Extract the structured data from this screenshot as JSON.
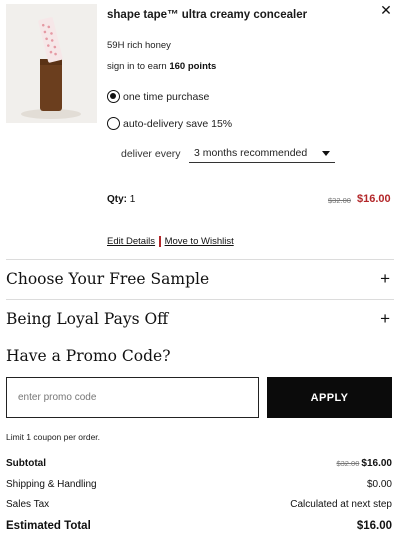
{
  "product": {
    "name": "shape tape™ ultra creamy concealer",
    "shade": "59H rich honey",
    "points_prefix": "sign in to earn",
    "points_value": "160 points",
    "close_icon": "close-icon",
    "purchase_options": [
      {
        "label": "one time purchase",
        "selected": true
      },
      {
        "label": "auto-delivery save 15%",
        "selected": false
      }
    ],
    "deliver_label": "deliver every",
    "deliver_value": "3 months recommended",
    "qty_label": "Qty:",
    "qty_value": "1",
    "price_original": "$32.00",
    "price_current": "$16.00",
    "edit_link": "Edit Details",
    "wishlist_link": "Move to Wishlist"
  },
  "accordions": [
    {
      "title": "Choose Your Free Sample",
      "icon": "plus-icon"
    },
    {
      "title": "Being Loyal Pays Off",
      "icon": "plus-icon"
    }
  ],
  "promo": {
    "title": "Have a Promo Code?",
    "placeholder": "enter promo code",
    "button": "APPLY",
    "limit_note": "Limit 1 coupon per order."
  },
  "summary": {
    "subtotal_label": "Subtotal",
    "subtotal_original": "$32.00",
    "subtotal_value": "$16.00",
    "shipping_label": "Shipping & Handling",
    "shipping_value": "$0.00",
    "tax_label": "Sales Tax",
    "tax_value": "Calculated at next step",
    "total_label": "Estimated Total",
    "total_value": "$16.00"
  },
  "colors": {
    "sale_red": "#b3272a",
    "button_black": "#0b0b0b",
    "divider": "#dcdcdc"
  }
}
